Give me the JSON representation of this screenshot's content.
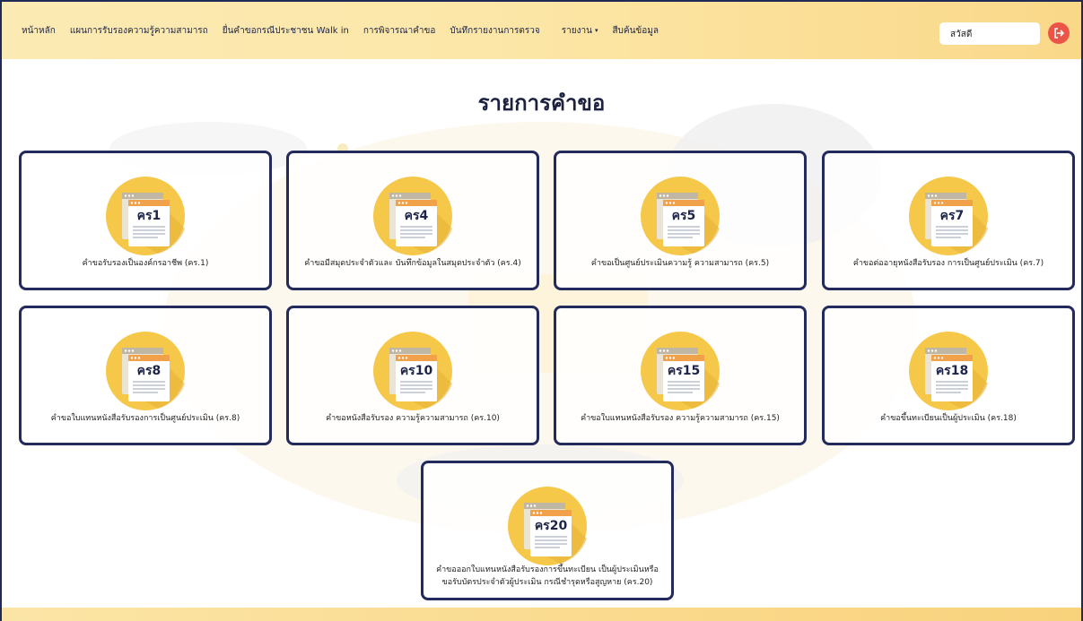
{
  "nav": {
    "links": [
      "หน้าหลัก",
      "แผนการรับรองความรู้ความสามารถ",
      "ยื่นคำขอกรณีประชาชน Walk in",
      "การพิจารณาคำขอ",
      "บันทึกรายงานการตรวจ",
      "รายงาน",
      "สืบค้นข้อมูล"
    ],
    "report_caret": "▾",
    "greeting": "สวัสดี"
  },
  "page": {
    "title": "รายการคำขอ"
  },
  "cards": [
    {
      "code": "คร1",
      "label": "คำขอรับรองเป็นองค์กรอาชีพ (คร.1)"
    },
    {
      "code": "คร4",
      "label": "คำขอมีสมุดประจำตัวและ บันทึกข้อมูลในสมุดประจำตัว (คร.4)"
    },
    {
      "code": "คร5",
      "label": "คำขอเป็นศูนย์ประเมินความรู้ ความสามารถ (คร.5)"
    },
    {
      "code": "คร7",
      "label": "คำขอต่ออายุหนังสือรับรอง การเป็นศูนย์ประเมิน (คร.7)"
    },
    {
      "code": "คร8",
      "label": "คำขอใบแทนหนังสือรับรองการเป็นศูนย์ประเมิน (คร.8)"
    },
    {
      "code": "คร10",
      "label": "คำขอหนังสือรับรอง ความรู้ความสามารถ (คร.10)"
    },
    {
      "code": "คร15",
      "label": "คำขอใบแทนหนังสือรับรอง ความรู้ความสามารถ (คร.15)"
    },
    {
      "code": "คร18",
      "label": "คำขอขึ้นทะเบียนเป็นผู้ประเมิน (คร.18)"
    },
    {
      "code": "คร20",
      "label": "คำขอออกใบแทนหนังสือรับรองการขึ้นทะเบียน เป็นผู้ประเมินหรือ ขอรับบัตรประจำตัวผู้ประเมิน กรณีชำรุดหรือสูญหาย (คร.20)"
    }
  ],
  "colors": {
    "accent": "#f5c842",
    "border": "#232a5c",
    "logout": "#ea5548"
  }
}
